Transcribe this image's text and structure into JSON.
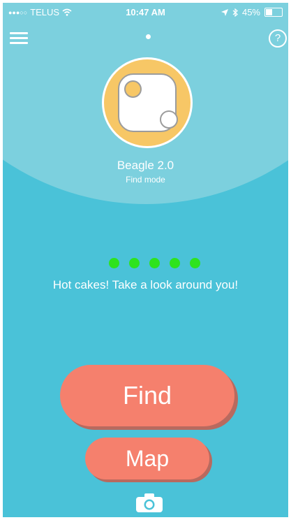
{
  "status_bar": {
    "carrier": "TELUS",
    "time": "10:47 AM",
    "battery_percent": "45%",
    "battery_level": 0.45
  },
  "header": {
    "menu_icon": "hamburger-menu-icon",
    "help_icon": "question-circle-icon",
    "help_glyph": "?"
  },
  "device": {
    "name": "Beagle 2.0",
    "mode": "Find mode",
    "icon": "tracker-device-icon"
  },
  "signal": {
    "dots_lit": 5,
    "dots_total": 5,
    "color": "#2ee31e",
    "message": "Hot cakes! Take a look around you!"
  },
  "actions": {
    "find_label": "Find",
    "map_label": "Map",
    "camera_icon": "camera-icon"
  },
  "colors": {
    "background": "#4ac2d8",
    "header_arc": "#7cd0de",
    "accent": "#f5806d",
    "device_ring": "#f7c766"
  }
}
